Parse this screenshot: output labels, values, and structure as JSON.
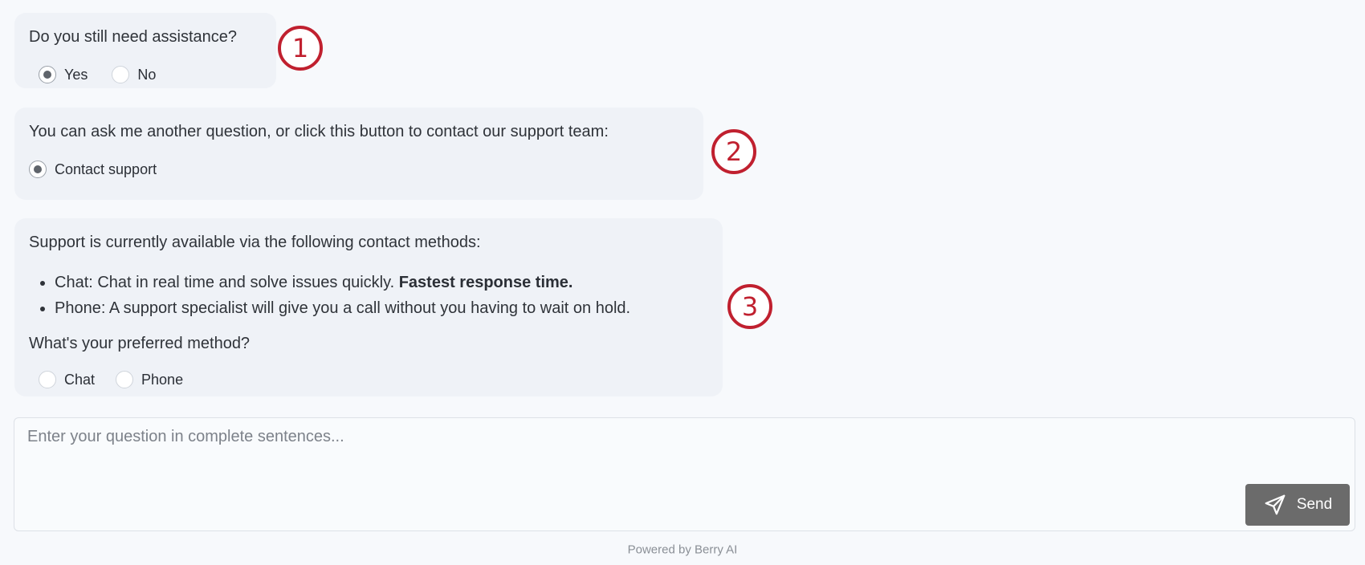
{
  "messages": {
    "assistance": {
      "question": "Do you still need assistance?",
      "options": [
        {
          "label": "Yes",
          "checked": true
        },
        {
          "label": "No",
          "checked": false
        }
      ]
    },
    "contact": {
      "text": "You can ask me another question, or click this button to contact our support team:",
      "option": {
        "label": "Contact support",
        "checked": true
      }
    },
    "methods": {
      "intro": "Support is currently available via the following contact methods:",
      "bullets": [
        {
          "text": "Chat: Chat in real time and solve issues quickly.",
          "bold": "Fastest response time."
        },
        {
          "text": "Phone: A support specialist will give you a call without you having to wait on hold.",
          "bold": ""
        }
      ],
      "question": "What's your preferred method?",
      "options": [
        {
          "label": "Chat",
          "checked": false
        },
        {
          "label": "Phone",
          "checked": false
        }
      ]
    }
  },
  "markers": [
    "1",
    "2",
    "3"
  ],
  "input": {
    "placeholder": "Enter your question in complete sentences...",
    "value": ""
  },
  "send_button": {
    "label": "Send",
    "icon": "send-icon"
  },
  "footer": "Powered by Berry AI",
  "colors": {
    "marker": "#c0202f",
    "bubble": "#eff2f7",
    "send_button": "#6b6b6b",
    "background": "#f7f9fc"
  }
}
